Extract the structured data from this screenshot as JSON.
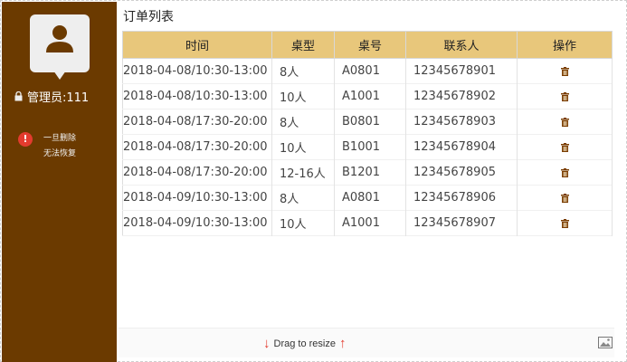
{
  "sidebar": {
    "admin_label": "管理员:111",
    "warning_line1": "一旦删除",
    "warning_line2": "无法恢复",
    "bg_color": "#6b3a00"
  },
  "main": {
    "title": "订单列表",
    "columns": [
      "时间",
      "桌型",
      "桌号",
      "联系人",
      "操作"
    ],
    "rows": [
      {
        "time": "2018-04-08/10:30-13:00",
        "type": "8人",
        "table_no": "A0801",
        "contact": "12345678901"
      },
      {
        "time": "2018-04-08/10:30-13:00",
        "type": "10人",
        "table_no": "A1001",
        "contact": "12345678902"
      },
      {
        "time": "2018-04-08/17:30-20:00",
        "type": "8人",
        "table_no": "B0801",
        "contact": "12345678903"
      },
      {
        "time": "2018-04-08/17:30-20:00",
        "type": "10人",
        "table_no": "B1001",
        "contact": "12345678904"
      },
      {
        "time": "2018-04-08/17:30-20:00",
        "type": "12-16人",
        "table_no": "B1201",
        "contact": "12345678905"
      },
      {
        "time": "2018-04-09/10:30-13:00",
        "type": "8人",
        "table_no": "A0801",
        "contact": "12345678906"
      },
      {
        "time": "2018-04-09/10:30-13:00",
        "type": "10人",
        "table_no": "A1001",
        "contact": "12345678907"
      }
    ],
    "header_color": "#e8c77b"
  },
  "footer": {
    "resize_label": "Drag to resize",
    "arrow_color": "#e33b2e"
  }
}
